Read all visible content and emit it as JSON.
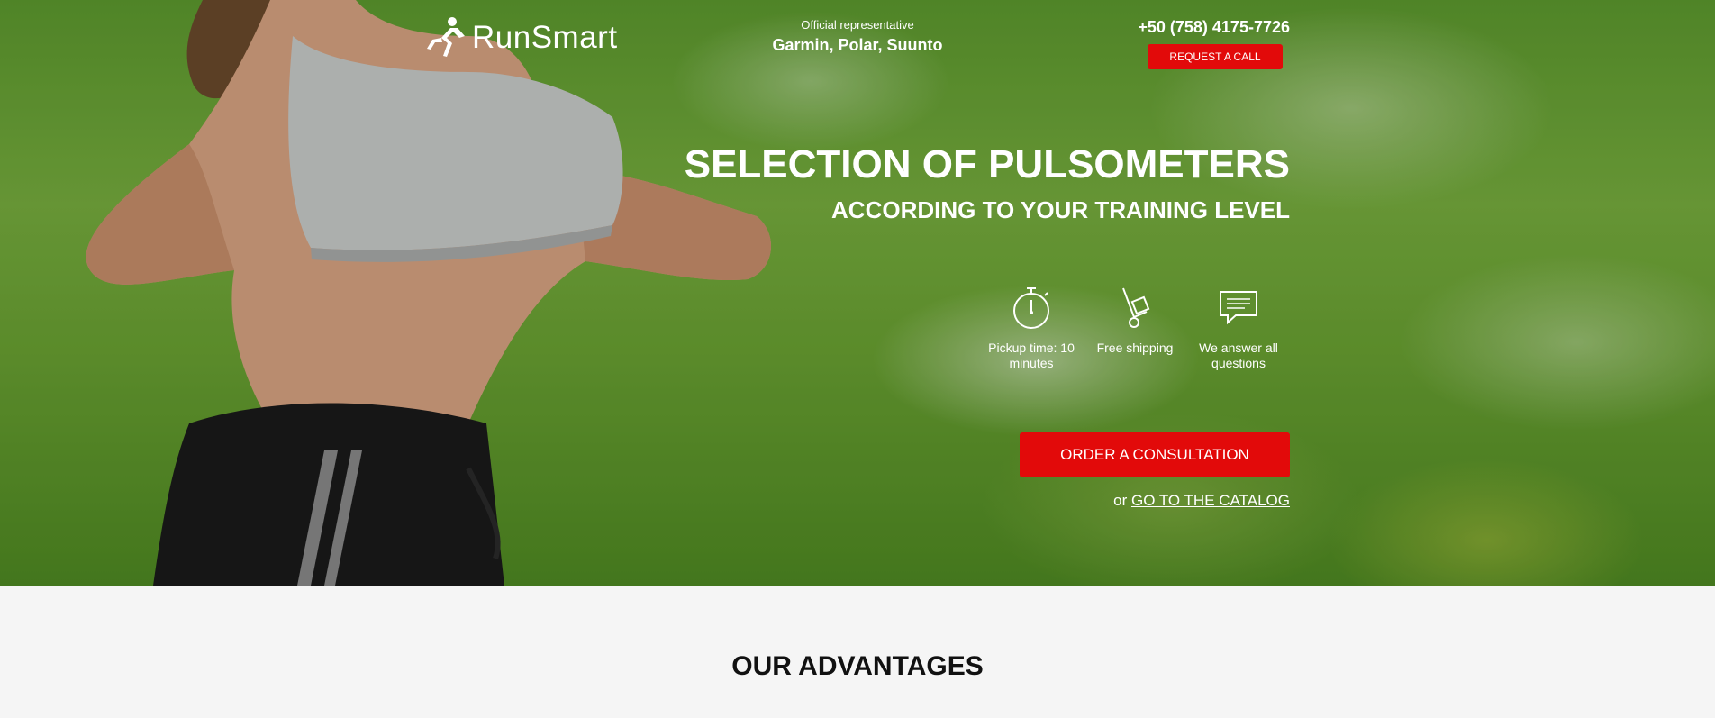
{
  "header": {
    "logo_text": "RunSmart",
    "rep_label": "Official representative",
    "rep_brands": "Garmin, Polar, Suunto",
    "phone": "+50 (758) 4175-7726",
    "call_button": "REQUEST A CALL"
  },
  "hero": {
    "title": "SELECTION OF PULSOMETERS",
    "subtitle": "ACCORDING TO YOUR TRAINING LEVEL",
    "features": [
      {
        "icon": "stopwatch-icon",
        "label": "Pickup time: 10 minutes"
      },
      {
        "icon": "hand-truck-icon",
        "label": "Free shipping"
      },
      {
        "icon": "chat-icon",
        "label": "We answer all questions"
      }
    ],
    "order_button": "ORDER A CONSULTATION",
    "catalog_prefix": "or",
    "catalog_link": "GO TO THE CATALOG"
  },
  "advantages": {
    "title": "OUR ADVANTAGES"
  },
  "colors": {
    "accent": "#e20a0a",
    "background": "#f5f5f5"
  }
}
